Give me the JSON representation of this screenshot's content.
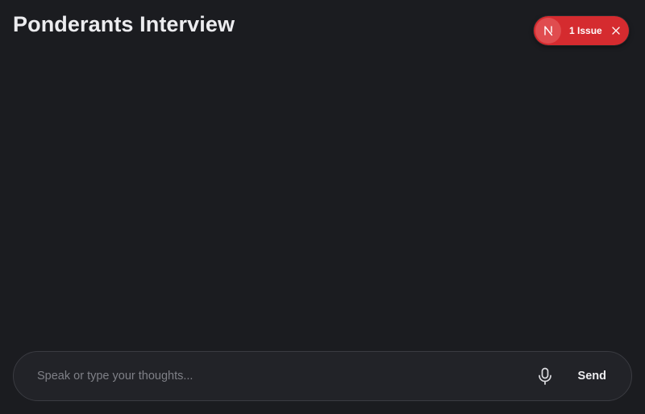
{
  "header": {
    "title": "Ponderants Interview"
  },
  "dev_indicator": {
    "badge_letter": "N",
    "issue_label": "1 Issue",
    "color": "#d52b2f"
  },
  "composer": {
    "placeholder": "Speak or type your thoughts...",
    "value": "",
    "mic_icon": "microphone-icon",
    "send_label": "Send"
  }
}
